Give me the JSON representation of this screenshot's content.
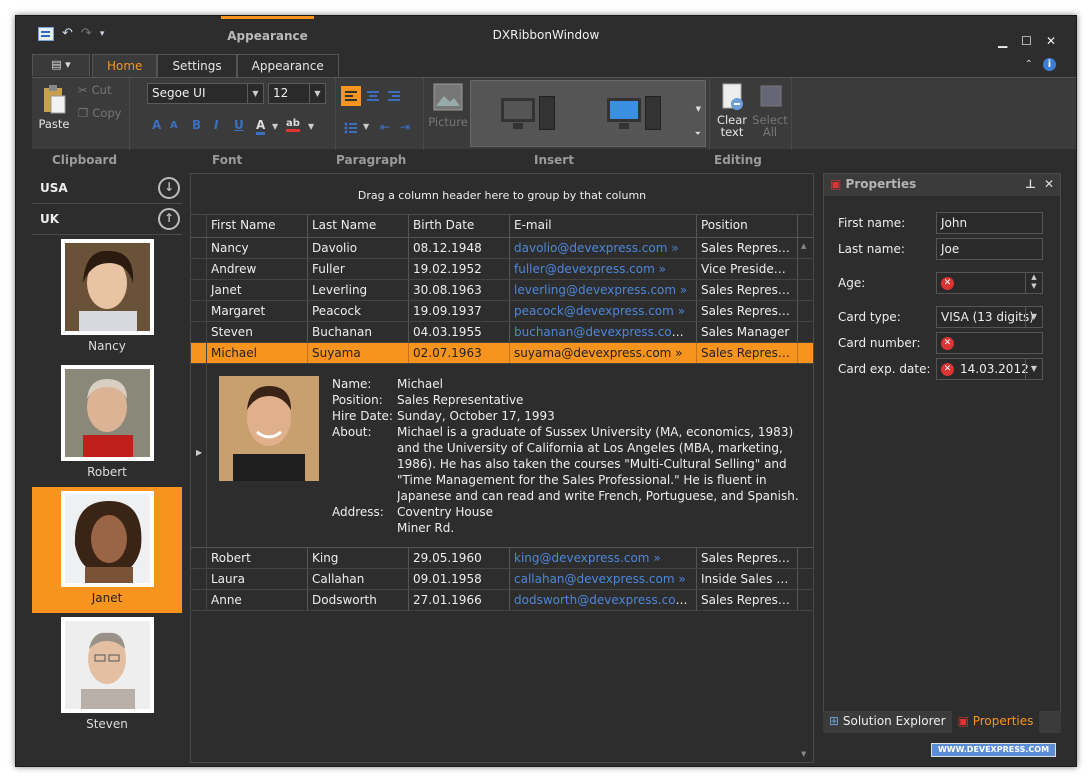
{
  "window": {
    "title": "DXRibbonWindow",
    "context_tab": "Appearance"
  },
  "ribbon": {
    "tabs": [
      "Home",
      "Settings",
      "Appearance"
    ],
    "clipboard": {
      "paste": "Paste",
      "cut": "Cut",
      "copy": "Copy"
    },
    "font": {
      "family": "Segoe UI",
      "size": "12"
    },
    "insert": {
      "picture": "Picture"
    },
    "editing": {
      "clear_line1": "Clear",
      "clear_line2": "text",
      "select_line1": "Select",
      "select_line2": "All"
    },
    "group_labels": [
      "Clipboard",
      "Font",
      "Paragraph",
      "Insert",
      "Editing"
    ]
  },
  "left_panel": {
    "groups": [
      "USA",
      "UK"
    ],
    "people": [
      "Nancy",
      "Robert",
      "Janet",
      "Steven"
    ],
    "selected": "Janet"
  },
  "grid": {
    "group_hint": "Drag a column header here to group by that column",
    "columns": [
      "First Name",
      "Last Name",
      "Birth Date",
      "E-mail",
      "Position"
    ],
    "rows_top": [
      [
        "Nancy",
        "Davolio",
        "08.12.1948",
        "davolio@devexpress.com",
        "Sales Represent..."
      ],
      [
        "Andrew",
        "Fuller",
        "19.02.1952",
        "fuller@devexpress.com",
        "Vice President,..."
      ],
      [
        "Janet",
        "Leverling",
        "30.08.1963",
        "leverling@devexpress.com",
        "Sales Represent..."
      ],
      [
        "Margaret",
        "Peacock",
        "19.09.1937",
        "peacock@devexpress.com",
        "Sales Represent..."
      ],
      [
        "Steven",
        "Buchanan",
        "04.03.1955",
        "buchanan@devexpress.com",
        "Sales Manager"
      ],
      [
        "Michael",
        "Suyama",
        "02.07.1963",
        "suyama@devexpress.com",
        "Sales Represent..."
      ]
    ],
    "selected_row": 5,
    "detail": {
      "labels": [
        "Name:",
        "Position:",
        "Hire Date:",
        "About:",
        "Address:"
      ],
      "name": "Michael",
      "position": "Sales Representative",
      "hire_date": "Sunday, October 17, 1993",
      "about": "Michael is a graduate of Sussex University (MA, economics, 1983) and the University of California at Los Angeles (MBA, marketing, 1986).  He has also taken the courses \"Multi-Cultural Selling\" and \"Time Management for the Sales Professional.\"  He is fluent in Japanese and can read and write French, Portuguese, and Spanish.",
      "address_line1": "Coventry House",
      "address_line2": "Miner Rd."
    },
    "rows_bottom": [
      [
        "Robert",
        "King",
        "29.05.1960",
        "king@devexpress.com",
        "Sales Represent..."
      ],
      [
        "Laura",
        "Callahan",
        "09.01.1958",
        "callahan@devexpress.com",
        "Inside Sales Co..."
      ],
      [
        "Anne",
        "Dodsworth",
        "27.01.1966",
        "dodsworth@devexpress.com",
        "Sales Represent..."
      ]
    ]
  },
  "properties": {
    "title": "Properties",
    "fields": [
      {
        "label": "First name:",
        "value": "John"
      },
      {
        "label": "Last name:",
        "value": "Joe"
      },
      {
        "label": "Age:",
        "value": ""
      },
      {
        "label": "Card type:",
        "value": "VISA (13 digits)"
      },
      {
        "label": "Card number:",
        "value": ""
      },
      {
        "label": "Card exp. date:",
        "value": "14.03.2012"
      }
    ],
    "tabs": [
      "Solution Explorer",
      "Properties"
    ]
  },
  "footer_badge": "WWW.DEVEXPRESS.COM",
  "colors": {
    "accent": "#f7941d",
    "link": "#4d86d9",
    "background": "#2d2d2d"
  }
}
